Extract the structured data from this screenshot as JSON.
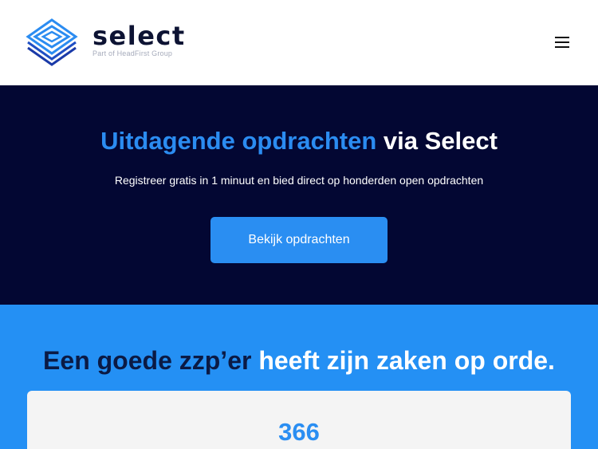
{
  "header": {
    "logo_word": "select",
    "logo_sub": "Part of HeadFirst Group",
    "menu_icon": "hamburger-menu-icon"
  },
  "hero": {
    "title_accent": "Uitdagende opdrachten",
    "title_plain": "via Select",
    "subtitle": "Registreer gratis in 1 minuut en bied direct op honderden open opdrachten",
    "cta_label": "Bekijk opdrachten"
  },
  "stats": {
    "title_dark": "Een goede zzp’er",
    "title_light": "heeft zijn zaken op orde.",
    "card_number": "366"
  },
  "colors": {
    "hero_bg": "#030733",
    "accent_blue": "#2a8ef2",
    "stats_bg": "#2490f4",
    "logo_text": "#0d1333"
  }
}
